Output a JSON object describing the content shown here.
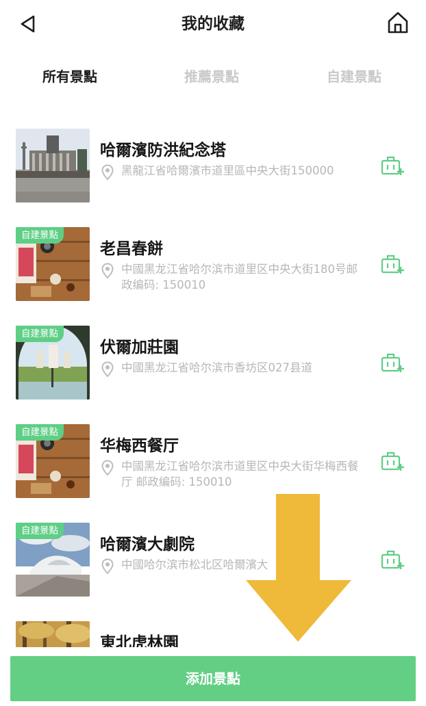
{
  "header": {
    "title": "我的收藏"
  },
  "tabs": [
    {
      "label": "所有景點",
      "active": true
    },
    {
      "label": "推薦景點",
      "active": false
    },
    {
      "label": "自建景點",
      "active": false
    }
  ],
  "colors": {
    "accent": "#5fce86",
    "arrow": "#efb93a",
    "inactive_tab": "#c9c9c9",
    "address": "#b7b7b7"
  },
  "items": [
    {
      "name": "哈爾濱防洪紀念塔",
      "address": "黑龍江省哈爾濱市道里區中央大街150000",
      "tag": ""
    },
    {
      "name": "老昌春餅",
      "address": "中國黑龙江省哈尔滨市道里区中央大街180号邮政编码: 150010",
      "tag": "自建景點"
    },
    {
      "name": "伏爾加莊園",
      "address": "中國黑龙江省哈尔滨市香坊区027县道",
      "tag": "自建景點"
    },
    {
      "name": "华梅西餐厅",
      "address": "中國黑龙江省哈尔滨市道里区中央大街华梅西餐厅 邮政编码: 150010",
      "tag": "自建景點"
    },
    {
      "name": "哈爾濱大劇院",
      "address": "中國哈尔滨市松北区哈爾濱大",
      "tag": "自建景點"
    },
    {
      "name": "東北虎林園",
      "address": "",
      "tag": ""
    }
  ],
  "icons": {
    "back": "back-arrow-icon",
    "home": "home-icon",
    "location": "location-pin-icon",
    "add_to_itinerary": "add-to-luggage-icon"
  },
  "bottom_button": {
    "label": "添加景點"
  }
}
